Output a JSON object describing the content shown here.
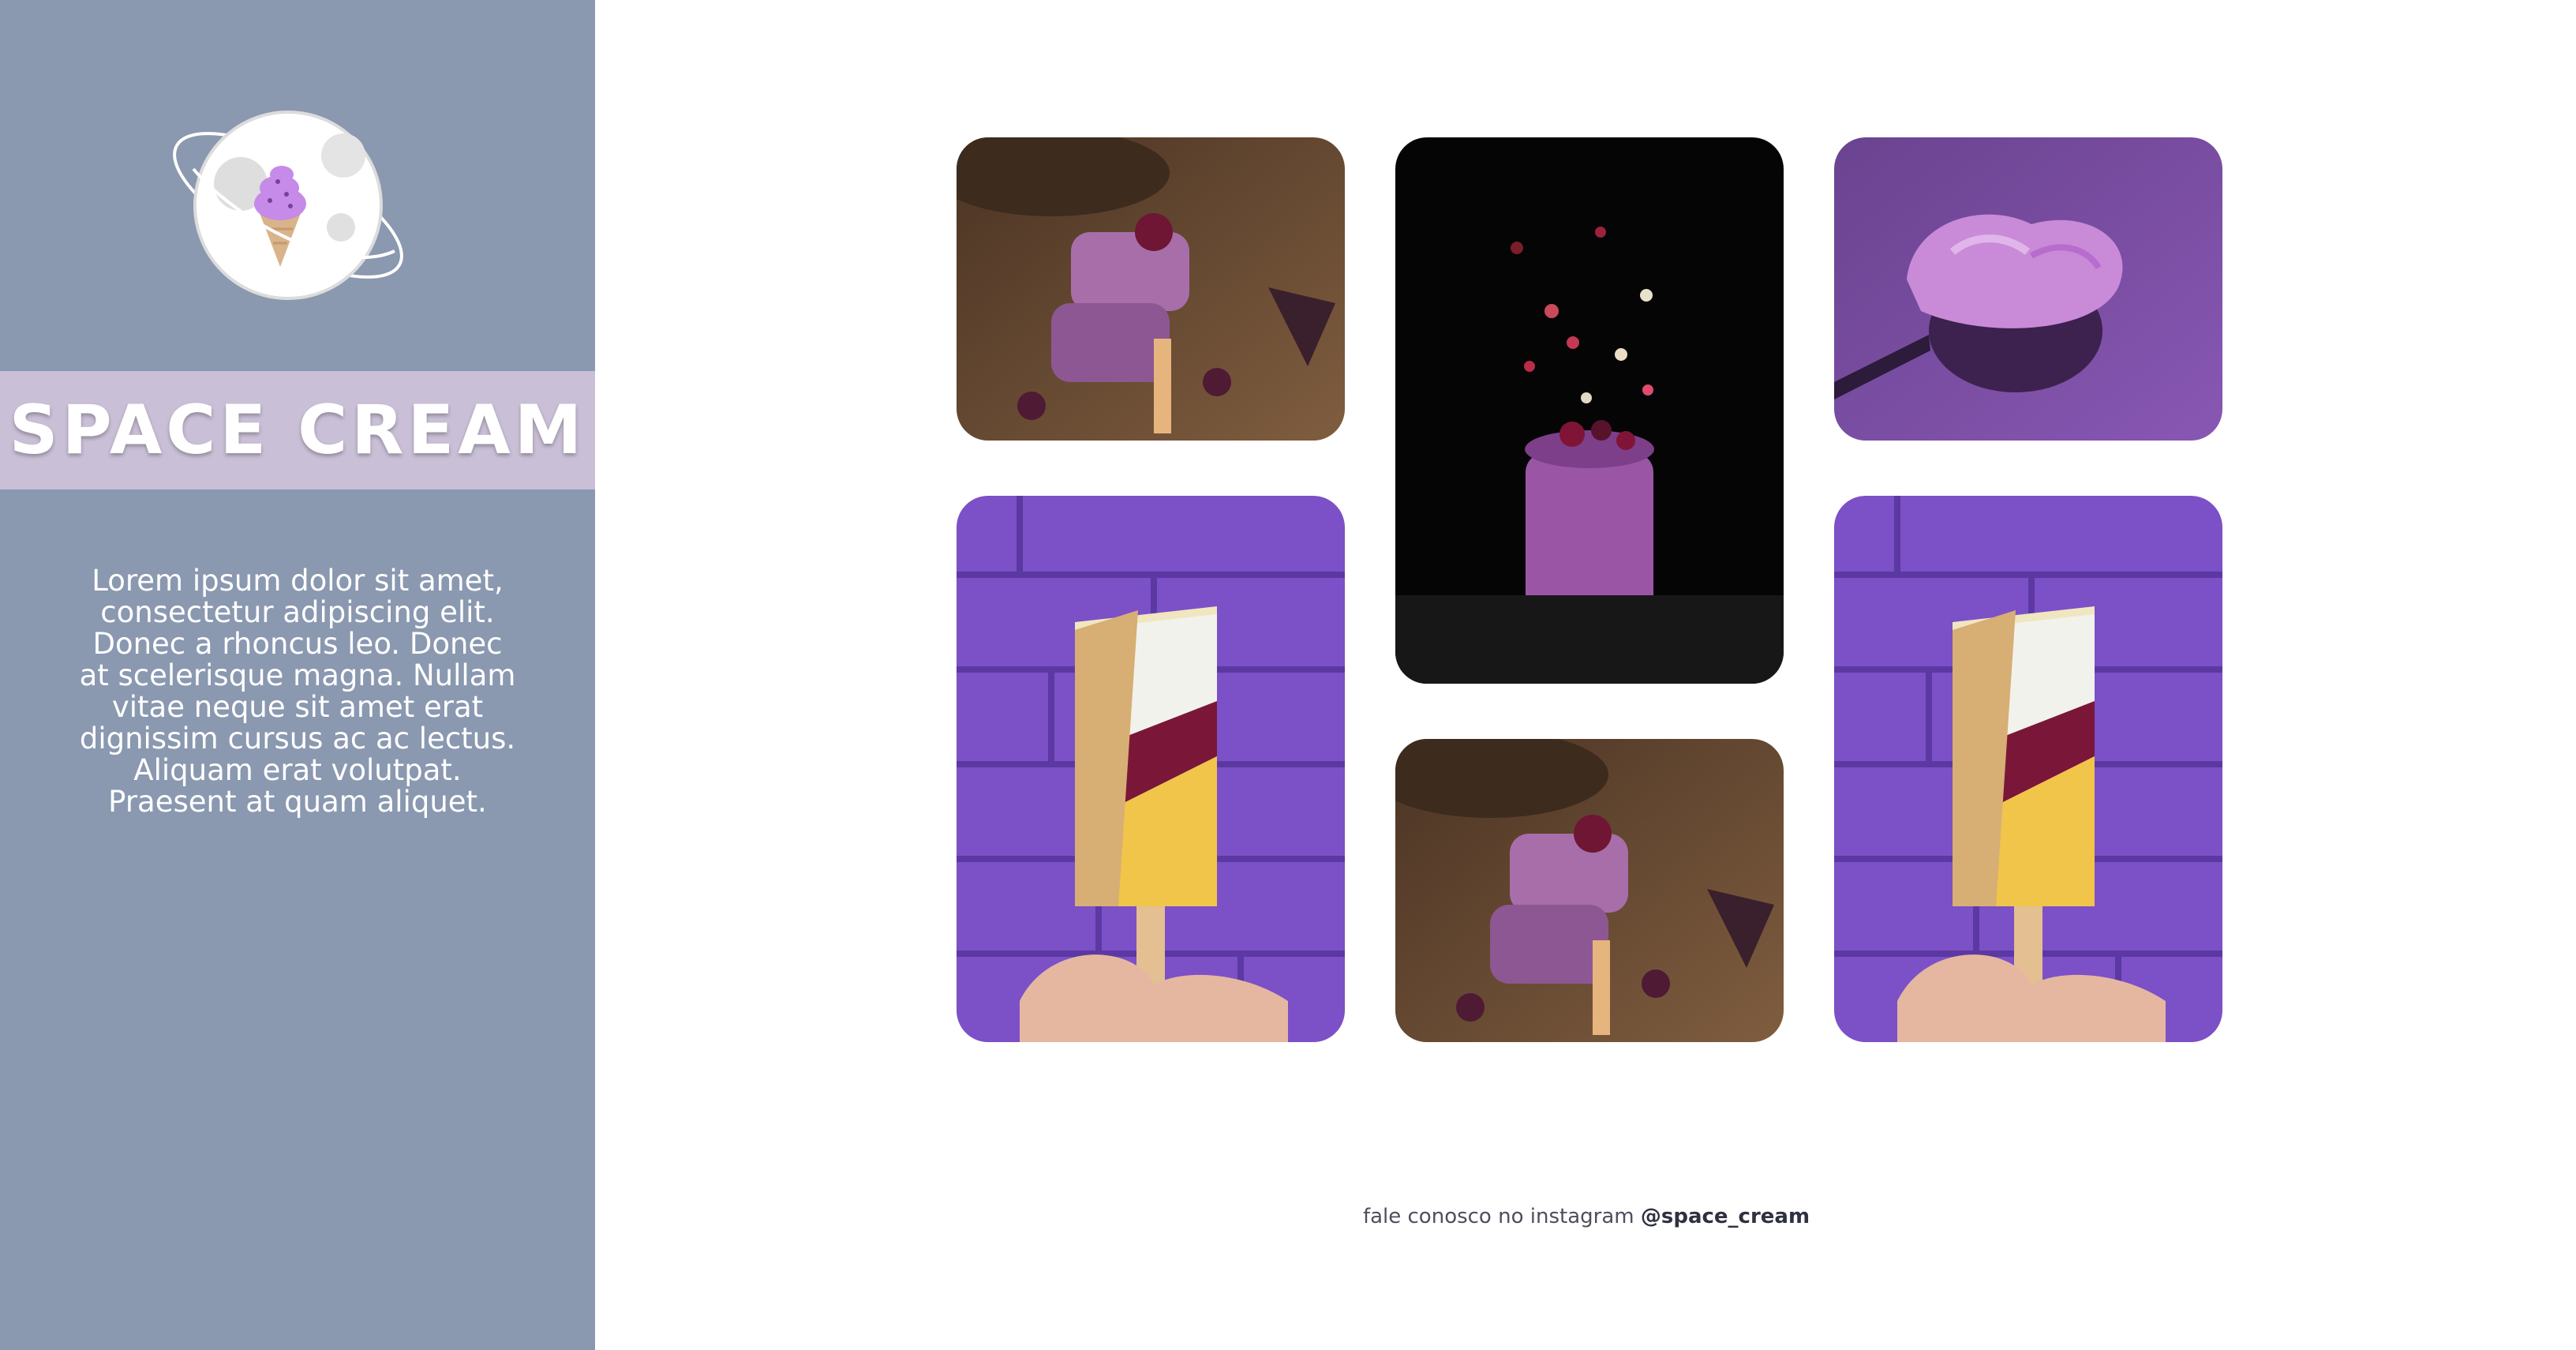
{
  "brand": {
    "title": "SPACE CREAM",
    "description": "Lorem ipsum dolor sit amet, consectetur adipiscing elit. Donec a rhoncus leo. Donec at scelerisque magna. Nullam vitae neque sit amet erat dignissim cursus ac ac lectus. Aliquam erat volutpat. Praesent at quam aliquet."
  },
  "gallery": {
    "photos": [
      {
        "name": "photo-popsicles-stack",
        "icon": "popsicle-stack-image"
      },
      {
        "name": "photo-smoothie-jar",
        "icon": "smoothie-jar-image"
      },
      {
        "name": "photo-cream-spoon",
        "icon": "cream-spoon-image"
      },
      {
        "name": "photo-yellow-popsicle",
        "icon": "yellow-popsicle-image"
      },
      {
        "name": "photo-popsicles-stack-2",
        "icon": "popsicle-stack-image"
      },
      {
        "name": "photo-yellow-popsicle-2",
        "icon": "yellow-popsicle-image"
      }
    ]
  },
  "footer": {
    "text": "fale conosco no instagram ",
    "handle": "@space_cream"
  },
  "colors": {
    "sidebar": "#8a98b0",
    "band": "#c9bfd6",
    "accent_purple": "#8e5fd6"
  }
}
